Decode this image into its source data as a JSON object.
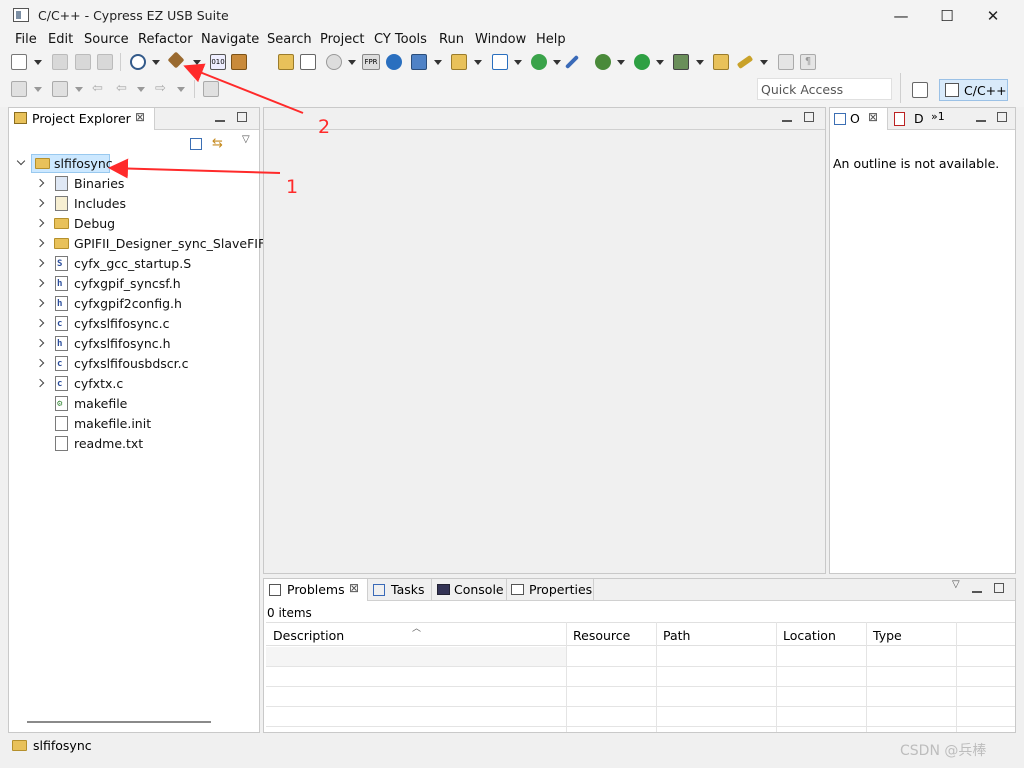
{
  "window": {
    "title": "C/C++ - Cypress EZ USB Suite",
    "minimize": "—",
    "maximize": "☐",
    "close": "✕"
  },
  "menu": [
    "File",
    "Edit",
    "Source",
    "Refactor",
    "Navigate",
    "Search",
    "Project",
    "CY Tools",
    "Run",
    "Window",
    "Help"
  ],
  "toolbar": {
    "quick_access_placeholder": "Quick Access",
    "perspective": "C/C++"
  },
  "project_explorer": {
    "tab": "Project Explorer",
    "root": "slfifosync",
    "items": [
      {
        "label": "Binaries",
        "icon": "binaries-icon",
        "expandable": true
      },
      {
        "label": "Includes",
        "icon": "includes-icon",
        "expandable": true
      },
      {
        "label": "Debug",
        "icon": "folder-icon",
        "expandable": true
      },
      {
        "label": "GPIFII_Designer_sync_SlaveFIFO",
        "icon": "folder-icon",
        "expandable": true
      },
      {
        "label": "cyfx_gcc_startup.S",
        "icon": "asm-file-icon",
        "expandable": true,
        "glyph": "S"
      },
      {
        "label": "cyfxgpif_syncsf.h",
        "icon": "header-file-icon",
        "expandable": true,
        "glyph": "h"
      },
      {
        "label": "cyfxgpif2config.h",
        "icon": "header-file-icon",
        "expandable": true,
        "glyph": "h"
      },
      {
        "label": "cyfxslfifosync.c",
        "icon": "c-file-icon",
        "expandable": true,
        "glyph": "c"
      },
      {
        "label": "cyfxslfifosync.h",
        "icon": "header-file-icon",
        "expandable": true,
        "glyph": "h"
      },
      {
        "label": "cyfxslfifousbdscr.c",
        "icon": "c-file-icon",
        "expandable": true,
        "glyph": "c"
      },
      {
        "label": "cyfxtx.c",
        "icon": "c-file-icon",
        "expandable": true,
        "glyph": "c"
      },
      {
        "label": "makefile",
        "icon": "makefile-icon",
        "expandable": false
      },
      {
        "label": "makefile.init",
        "icon": "text-file-icon",
        "expandable": false
      },
      {
        "label": "readme.txt",
        "icon": "text-file-icon",
        "expandable": false
      }
    ]
  },
  "outline": {
    "tab_o": "O",
    "tab_d": "D",
    "tab_more": "»1",
    "message": "An outline is not available."
  },
  "bottom_tabs": [
    "Problems",
    "Tasks",
    "Console",
    "Properties"
  ],
  "problems": {
    "count": "0 items",
    "columns": [
      "Description",
      "Resource",
      "Path",
      "Location",
      "Type"
    ]
  },
  "status": {
    "selection": "slfifosync"
  },
  "annotations": {
    "arrow1": "1",
    "arrow2": "2"
  },
  "watermark": "CSDN @兵棒",
  "colors": {
    "selection": "#cce8ff",
    "accent_blue": "#3c7fc4",
    "arrow_red": "#ff2a2a"
  }
}
